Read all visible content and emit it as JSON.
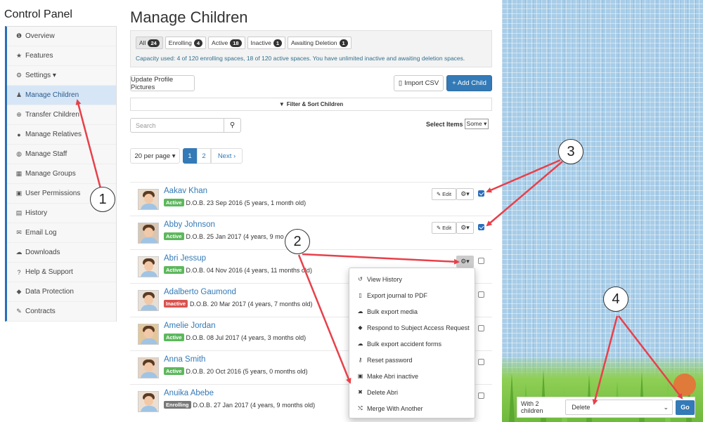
{
  "control_panel_title": "Control Panel",
  "sidebar": {
    "items": [
      {
        "icon": "info-icon",
        "glyph": "❶",
        "label": "Overview"
      },
      {
        "icon": "star-icon",
        "glyph": "★",
        "label": "Features"
      },
      {
        "icon": "gear-icon",
        "glyph": "⚙",
        "label": "Settings ▾"
      },
      {
        "icon": "child-icon",
        "glyph": "♟",
        "label": "Manage Children",
        "active": true
      },
      {
        "icon": "transfer-icon",
        "glyph": "⊕",
        "label": "Transfer Children"
      },
      {
        "icon": "user-icon",
        "glyph": "●",
        "label": "Manage Relatives"
      },
      {
        "icon": "users-icon",
        "glyph": "◍",
        "label": "Manage Staff"
      },
      {
        "icon": "grid-icon",
        "glyph": "▦",
        "label": "Manage Groups"
      },
      {
        "icon": "lock-icon",
        "glyph": "▣",
        "label": "User Permissions"
      },
      {
        "icon": "calendar-icon",
        "glyph": "▤",
        "label": "History"
      },
      {
        "icon": "envelope-icon",
        "glyph": "✉",
        "label": "Email Log"
      },
      {
        "icon": "cloud-download-icon",
        "glyph": "☁",
        "label": "Downloads"
      },
      {
        "icon": "question-icon",
        "glyph": "?",
        "label": "Help & Support"
      },
      {
        "icon": "shield-icon",
        "glyph": "◆",
        "label": "Data Protection"
      },
      {
        "icon": "pencil-icon",
        "glyph": "✎",
        "label": "Contracts"
      }
    ]
  },
  "page_title": "Manage Children",
  "tabs": [
    {
      "label": "All",
      "count": "24",
      "active": true
    },
    {
      "label": "Enrolling",
      "count": "4"
    },
    {
      "label": "Active",
      "count": "18"
    },
    {
      "label": "Inactive",
      "count": "1"
    },
    {
      "label": "Awaiting Deletion",
      "count": "1"
    }
  ],
  "capacity_text": "Capacity used: 4 of 120 enrolling spaces, 18 of 120 active spaces. You have unlimited inactive and awaiting deletion spaces.",
  "toolbar": {
    "update_pictures": "Update Profile Pictures",
    "import_csv": "Import CSV",
    "add_child": "+ Add Child"
  },
  "filter_label": "Filter & Sort Children",
  "search": {
    "placeholder": "Search"
  },
  "select_items": {
    "label": "Select Items",
    "value": "Some"
  },
  "pagination": {
    "per_page": "20 per page ▾",
    "pages": [
      "1",
      "2"
    ],
    "next": "Next"
  },
  "row_actions": {
    "edit": "Edit"
  },
  "children": [
    {
      "name": "Aakav Khan",
      "status": "Active",
      "status_color": "#5cb85c",
      "dob": "D.O.B. 23 Sep 2016 (5 years, 1 month old)",
      "checked": true
    },
    {
      "name": "Abby Johnson",
      "status": "Active",
      "status_color": "#5cb85c",
      "dob": "D.O.B. 25 Jan 2017 (4 years, 9 mo",
      "checked": true
    },
    {
      "name": "Abri Jessup",
      "status": "Active",
      "status_color": "#5cb85c",
      "dob": "D.O.B. 04 Nov 2016 (4 years, 11 months old)",
      "checked": false,
      "menu_open": true
    },
    {
      "name": "Adalberto Gaumond",
      "status": "Inactive",
      "status_color": "#d9534f",
      "dob": "D.O.B. 20 Mar 2017 (4 years, 7 months old)",
      "checked": false
    },
    {
      "name": "Amelie Jordan",
      "status": "Active",
      "status_color": "#5cb85c",
      "dob": "D.O.B. 08 Jul 2017 (4 years, 3 months old)",
      "checked": false
    },
    {
      "name": "Anna Smith",
      "status": "Active",
      "status_color": "#5cb85c",
      "dob": "D.O.B. 20 Oct 2016 (5 years, 0 months old)",
      "checked": false
    },
    {
      "name": "Anuika Abebe",
      "status": "Enrolling",
      "status_color": "#777777",
      "dob": "D.O.B. 27 Jan 2017 (4 years, 9 months old)",
      "checked": false
    }
  ],
  "dropdown_menu": [
    {
      "icon": "history-icon",
      "glyph": "↺",
      "label": "View History"
    },
    {
      "icon": "file-pdf-icon",
      "glyph": "▯",
      "label": "Export journal to PDF"
    },
    {
      "icon": "cloud-download-icon",
      "glyph": "☁",
      "label": "Bulk export media"
    },
    {
      "icon": "shield-icon",
      "glyph": "◆",
      "label": "Respond to Subject Access Request"
    },
    {
      "icon": "cloud-download-icon",
      "glyph": "☁",
      "label": "Bulk export accident forms"
    },
    {
      "icon": "key-icon",
      "glyph": "⚷",
      "label": "Reset password"
    },
    {
      "icon": "lock-icon",
      "glyph": "▣",
      "label": "Make Abri inactive"
    },
    {
      "icon": "close-icon",
      "glyph": "✖",
      "label": "Delete Abri"
    },
    {
      "icon": "merge-icon",
      "glyph": "⤭",
      "label": "Merge With Another"
    }
  ],
  "bulk_action": {
    "label": "With 2 children",
    "value": "Delete",
    "go": "Go"
  },
  "callouts": [
    "1",
    "2",
    "3",
    "4"
  ]
}
